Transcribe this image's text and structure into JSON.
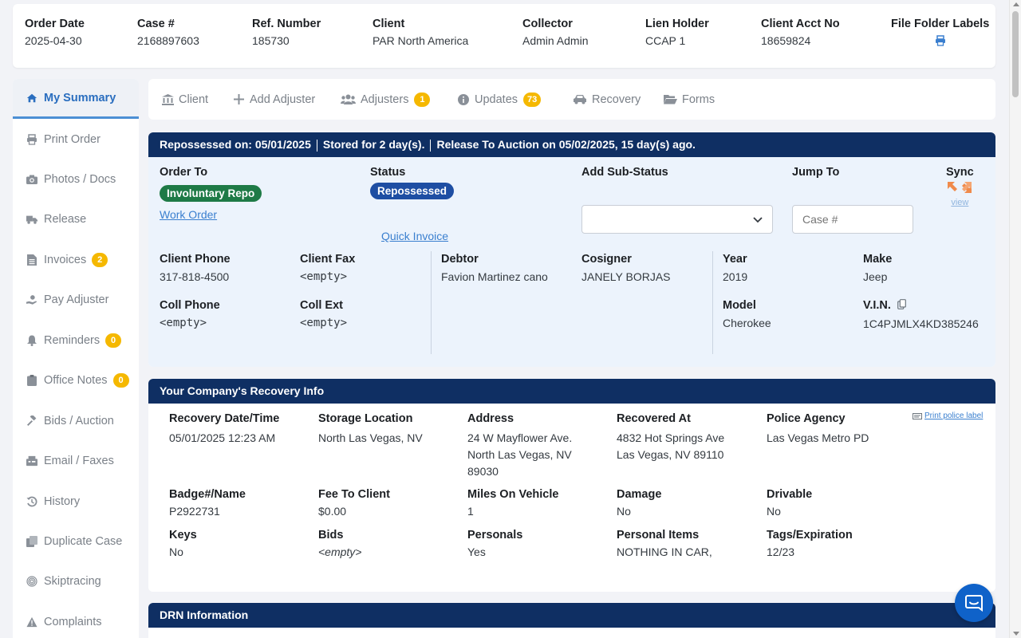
{
  "header": {
    "order_date": {
      "label": "Order Date",
      "value": "2025-04-30"
    },
    "case_no": {
      "label": "Case #",
      "value": "2168897603"
    },
    "ref_number": {
      "label": "Ref. Number",
      "value": "185730"
    },
    "client": {
      "label": "Client",
      "value": "PAR North America"
    },
    "collector": {
      "label": "Collector",
      "value": "Admin Admin"
    },
    "lien_holder": {
      "label": "Lien Holder",
      "value": "CCAP 1"
    },
    "client_acct": {
      "label": "Client Acct No",
      "value": "18659824"
    },
    "file_folder_labels": {
      "label": "File Folder Labels",
      "icon": "print-icon"
    }
  },
  "sidebar": {
    "items": [
      {
        "label": "My Summary",
        "icon": "home-icon",
        "active": true
      },
      {
        "label": "Print Order",
        "icon": "print-icon"
      },
      {
        "label": "Photos / Docs",
        "icon": "camera-icon"
      },
      {
        "label": "Release",
        "icon": "truck-icon"
      },
      {
        "label": "Invoices",
        "icon": "invoice-icon",
        "badge": "2"
      },
      {
        "label": "Pay Adjuster",
        "icon": "hand-money-icon"
      },
      {
        "label": "Reminders",
        "icon": "bell-icon",
        "badge": "0"
      },
      {
        "label": "Office Notes",
        "icon": "clipboard-icon",
        "badge": "0"
      },
      {
        "label": "Bids / Auction",
        "icon": "gavel-icon"
      },
      {
        "label": "Email / Faxes",
        "icon": "fax-icon"
      },
      {
        "label": "History",
        "icon": "history-icon"
      },
      {
        "label": "Duplicate Case",
        "icon": "copy-icon"
      },
      {
        "label": "Skiptracing",
        "icon": "fingerprint-icon"
      },
      {
        "label": "Complaints",
        "icon": "warning-icon"
      }
    ]
  },
  "tabs": [
    {
      "label": "Client",
      "icon": "bank-icon"
    },
    {
      "label": "Add Adjuster",
      "icon": "plus-icon"
    },
    {
      "label": "Adjusters",
      "icon": "users-icon",
      "badge": "1"
    },
    {
      "label": "Updates",
      "icon": "info-icon",
      "badge": "73"
    },
    {
      "label": "Recovery",
      "icon": "car-icon"
    },
    {
      "label": "Forms",
      "icon": "folder-icon"
    }
  ],
  "repo_panel": {
    "repossessed_on": "Repossessed on: 05/01/2025",
    "stored_for": "Stored for 2 day(s).",
    "release_to_auction": "Release To Auction on 05/02/2025, 15 day(s) ago.",
    "order_to_label": "Order To",
    "order_to_value": "Involuntary Repo",
    "work_order_link": "Work Order",
    "status_label": "Status",
    "status_value": "Repossessed",
    "quick_invoice_link": "Quick Invoice",
    "sub_status_label": "Add Sub-Status",
    "sub_status_value": "",
    "jump_to_label": "Jump To",
    "jump_to_placeholder": "Case #",
    "sync_label": "Sync",
    "sync_view_link": "view",
    "client_phone": {
      "label": "Client Phone",
      "value": "317-818-4500"
    },
    "client_fax": {
      "label": "Client Fax",
      "value": "<empty>"
    },
    "coll_phone": {
      "label": "Coll Phone",
      "value": "<empty>"
    },
    "coll_ext": {
      "label": "Coll Ext",
      "value": "<empty>"
    },
    "debtor": {
      "label": "Debtor",
      "value": "Favion Martinez cano"
    },
    "cosigner": {
      "label": "Cosigner",
      "value": "JANELY BORJAS"
    },
    "year": {
      "label": "Year",
      "value": "2019"
    },
    "make": {
      "label": "Make",
      "value": "Jeep"
    },
    "model": {
      "label": "Model",
      "value": "Cherokee"
    },
    "vin": {
      "label": "V.I.N.",
      "value": "1C4PJMLX4KD385246"
    }
  },
  "recovery_panel": {
    "title": "Your Company's Recovery Info",
    "print_police_label": "Print police label",
    "recovery_datetime": {
      "label": "Recovery Date/Time",
      "value": "05/01/2025 12:23 AM"
    },
    "storage_location": {
      "label": "Storage Location",
      "value": "North Las Vegas, NV"
    },
    "address": {
      "label": "Address",
      "line1": "24 W Mayflower Ave.",
      "line2": "North Las Vegas, NV",
      "line3": "89030"
    },
    "recovered_at": {
      "label": "Recovered At",
      "line1": "4832 Hot Springs Ave",
      "line2": "Las Vegas, NV 89110"
    },
    "police_agency": {
      "label": "Police Agency",
      "value": "Las Vegas Metro PD"
    },
    "badge_name": {
      "label": "Badge#/Name",
      "value": "P2922731"
    },
    "fee_to_client": {
      "label": "Fee To Client",
      "value": "$0.00"
    },
    "miles_on_vehicle": {
      "label": "Miles On Vehicle",
      "value": "1"
    },
    "damage": {
      "label": "Damage",
      "value": "No"
    },
    "drivable": {
      "label": "Drivable",
      "value": "No"
    },
    "keys": {
      "label": "Keys",
      "value": "No"
    },
    "bids": {
      "label": "Bids",
      "value": "<empty>"
    },
    "personals": {
      "label": "Personals",
      "value": "Yes"
    },
    "personal_items": {
      "label": "Personal Items",
      "value": "NOTHING IN CAR,"
    },
    "tags_expiration": {
      "label": "Tags/Expiration",
      "value": "12/23"
    }
  },
  "drn_panel": {
    "title": "DRN Information"
  },
  "colors": {
    "navy": "#0f2f63",
    "accent": "#2a6ebf",
    "badge": "#f5b800",
    "green": "#1e7a46",
    "blue": "#1e4ea3"
  }
}
